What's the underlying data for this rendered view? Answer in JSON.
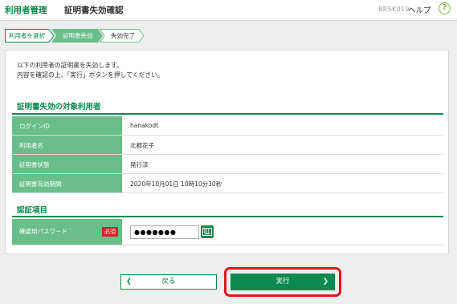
{
  "header": {
    "section": "利用者管理",
    "title": "証明書失効確認",
    "screen_code": "BRSK019",
    "help": "ヘルプ",
    "help_icon": "?"
  },
  "steps": [
    {
      "label": "利用者を選択",
      "state": "done"
    },
    {
      "label": "証明書失効",
      "state": "current"
    },
    {
      "label": "失効完了",
      "state": "pending"
    }
  ],
  "intro": {
    "line1": "以下の利用者の証明書を失効します。",
    "line2": "内容を確認の上、「実行」ボタンを押してください。"
  },
  "target_section": {
    "title": "証明書失効の対象利用者",
    "rows": [
      {
        "label": "ログインID",
        "value": "hanakodt"
      },
      {
        "label": "利用者名",
        "value": "北都花子"
      },
      {
        "label": "証明書状態",
        "value": "発行済"
      },
      {
        "label": "証明書有効期間",
        "value": "2020年10月01日 10時10分30秒"
      }
    ]
  },
  "auth_section": {
    "title": "認証項目",
    "password_label": "確認用パスワード",
    "required_badge": "必須",
    "password_value": "●●●●●●●"
  },
  "buttons": {
    "back": "戻る",
    "back_arrow": "❮",
    "execute": "実行",
    "execute_arrow": "❯"
  },
  "colors": {
    "primary_green": "#0a8a4c",
    "label_green": "#69be8a",
    "required_red": "#c62828",
    "highlight_red": "#e3141e"
  }
}
